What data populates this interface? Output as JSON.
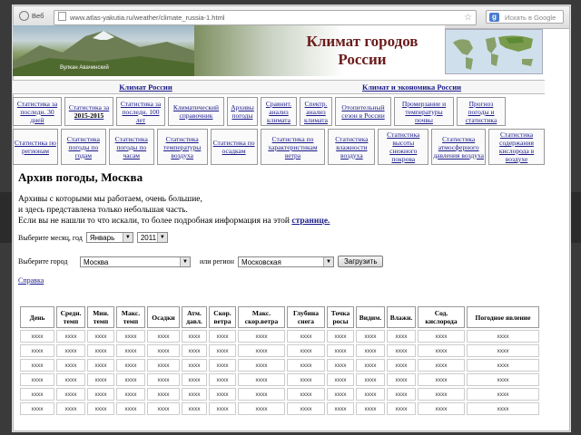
{
  "browser": {
    "tab_label": "Веб",
    "url": "www.atlas-yakutia.ru/weather/climate_russia-1.html",
    "search_placeholder": "Искать в Google"
  },
  "banner": {
    "title_line1": "Климат городов",
    "title_line2": "России",
    "photo_caption": "Вулкан Авачинский"
  },
  "sections": [
    "Климат России",
    "Климат и экономика России"
  ],
  "nav_row1": [
    {
      "label": "Статистика за последн. 30 дней",
      "w": 54
    },
    {
      "label": "Статистика за",
      "bold": "2015-2015",
      "w": 54
    },
    {
      "label": "Статистика за последн. 100 лет",
      "w": 54
    },
    {
      "label": "Климатический справочник",
      "w": 62
    },
    {
      "label": "Архивы погоды",
      "w": 34
    },
    {
      "label": "Сравнит. анализ климата",
      "w": 40
    },
    {
      "label": "Спектр. анализ климата",
      "w": 36
    },
    {
      "label": "Отопительный сезон в России",
      "w": 62
    },
    {
      "label": "Промерзание и температуры почвы",
      "w": 66
    },
    {
      "label": "Прогноз погоды и статистика",
      "w": 54
    }
  ],
  "nav_row2": [
    {
      "label": "Статистика по регионам",
      "w": 50
    },
    {
      "label": "Статистика погоды по годам",
      "w": 50
    },
    {
      "label": "Статистика погоды по часам",
      "w": 50
    },
    {
      "label": "Статистика температуры воздуха",
      "w": 56
    },
    {
      "label": "Статистика по осадкам",
      "w": 52
    },
    {
      "label": "Статистика по характеристикам ветра",
      "w": 72
    },
    {
      "label": "Статистика влажности воздуха",
      "w": 52
    },
    {
      "label": "Статистика высоты снежного покрова",
      "w": 56
    },
    {
      "label": "Статистика атмосферного давления воздуха",
      "w": 60
    },
    {
      "label": "Статистика содержания кислорода в воздухе",
      "w": 62
    }
  ],
  "content": {
    "heading": "Архив погоды, Москва",
    "para_line1": "Архивы с которыми мы работаем, очень большие,",
    "para_line2": "и здесь представлена только небольшая часть.",
    "para_line3": "Если вы не нашли то что искали, то более подробная информация на этой",
    "para_link": "странице.",
    "month_label": "Выберите месяц, год",
    "month_value": "Январь",
    "year_value": "2011",
    "city_label": "Выберите город",
    "city_value": "Москва",
    "region_label": "или регион",
    "region_value": "Московская",
    "load_button": "Загрузить",
    "help_link": "Справка"
  },
  "table": {
    "columns": [
      "День",
      "Средн. темп",
      "Мин. темп",
      "Макс. темп",
      "Осадки",
      "Атм. давл.",
      "Скор. ветра",
      "Макс. скор.ветра",
      "Глубина снега",
      "Точка росы",
      "Видим.",
      "Влажн.",
      "Сод. кислорода",
      "Погодное явление"
    ],
    "cell": "xxxx",
    "row_count": 6
  }
}
